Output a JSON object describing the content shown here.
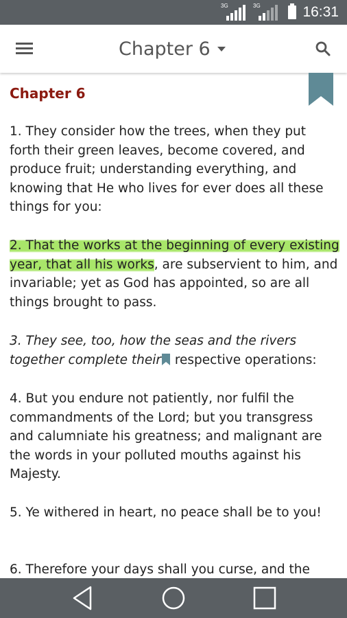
{
  "status_bar": {
    "time": "16:31",
    "network_1": "3G",
    "network_2": "3G"
  },
  "app_bar": {
    "title": "Chapter 6",
    "icons": [
      "menu-icon",
      "dropdown-caret-icon",
      "search-icon"
    ]
  },
  "content": {
    "chapter_heading": "Chapter 6",
    "verses": [
      {
        "text": "1. They consider how the trees, when they put forth their green leaves, become covered, and produce fruit; understanding everything, and knowing that He who lives for ever does all these things for you:"
      },
      {
        "highlight": "2. That the works at the beginning of every existing year, that all his works",
        "rest": ", are subservient to him, and invariable; yet as God has appointed, so are all things brought to pass."
      },
      {
        "before_bookmark": "3. They see, too, how the seas and the rivers together complete their",
        "after_bookmark": " respective operations:"
      },
      {
        "text": "4. But you endure not patiently, nor fulfil the commandments of the Lord; but you transgress and calumniate his greatness; and malignant are the words in your polluted mouths against his Majesty."
      },
      {
        "text": "5. Ye withered in heart, no peace shall be to you!"
      },
      {
        "text": "6. Therefore your days shall you curse, and the"
      }
    ]
  },
  "colors": {
    "status_bar": "#5a5f63",
    "chapter_heading": "#8b1a10",
    "highlight": "#a9e66a",
    "bookmark": "#5f8a96"
  },
  "nav_bar": {
    "icons": [
      "back-icon",
      "home-icon",
      "recents-icon"
    ]
  }
}
